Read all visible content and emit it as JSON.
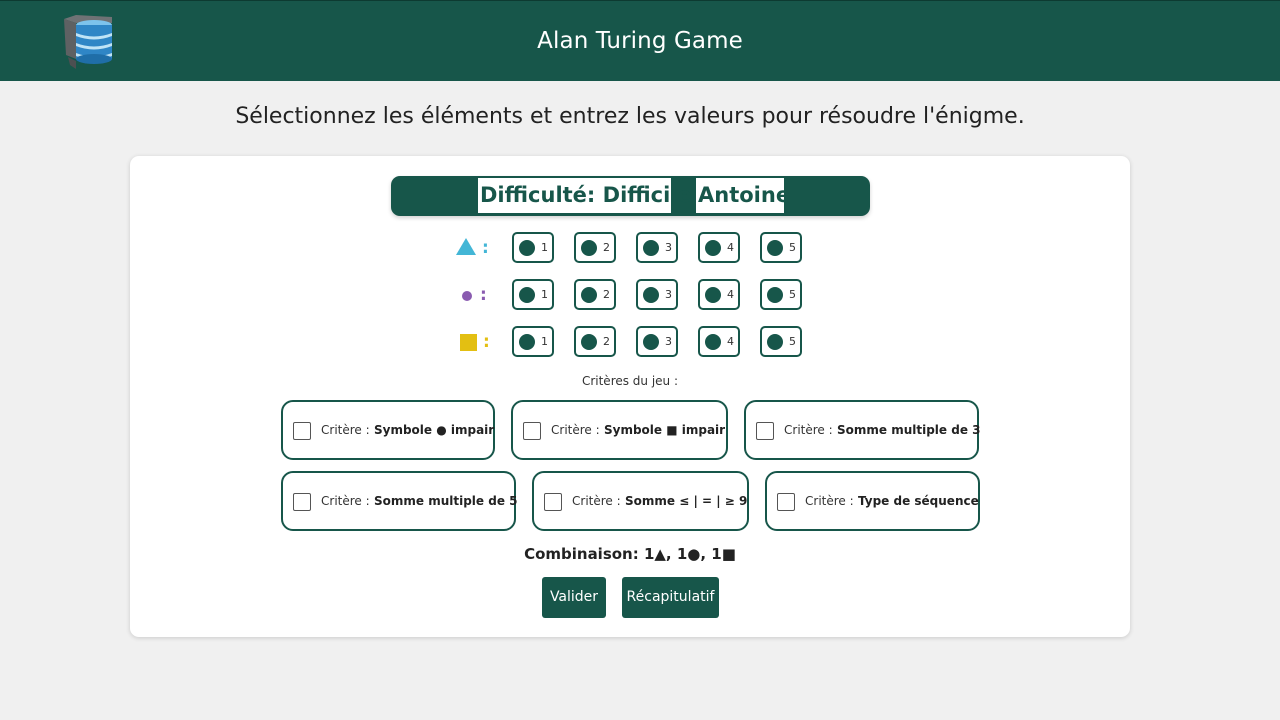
{
  "header": {
    "title": "Alan Turing Game",
    "logo_icon": "stacked-database-logo"
  },
  "instruction": "Sélectionnez les éléments et entrez les valeurs pour résoudre l'énigme.",
  "banner": {
    "difficulty": "Difficulté: Difficile",
    "player": "Antoine"
  },
  "rows": [
    {
      "symbol": "triangle",
      "color": "#43b6d6",
      "colon": ":",
      "options": [
        "1",
        "2",
        "3",
        "4",
        "5"
      ]
    },
    {
      "symbol": "circle",
      "color": "#8a5bb0",
      "colon": ":",
      "options": [
        "1",
        "2",
        "3",
        "4",
        "5"
      ]
    },
    {
      "symbol": "square",
      "color": "#e3bf12",
      "colon": ":",
      "options": [
        "1",
        "2",
        "3",
        "4",
        "5"
      ]
    }
  ],
  "criteria_title": "Critères du jeu :",
  "criteria": [
    {
      "label": "Critère :",
      "value": "Symbole ● impair",
      "checked": false
    },
    {
      "label": "Critère :",
      "value": "Symbole ■ impair",
      "checked": false
    },
    {
      "label": "Critère :",
      "value": "Somme multiple de 3",
      "checked": false
    },
    {
      "label": "Critère :",
      "value": "Somme multiple de 5",
      "checked": false
    },
    {
      "label": "Critère :",
      "value": "Somme ≤ | = | ≥ 9",
      "checked": false
    },
    {
      "label": "Critère :",
      "value": "Type de séquence",
      "checked": false
    }
  ],
  "combination": "Combinaison: 1▲, 1●, 1■",
  "buttons": {
    "validate": "Valider",
    "summary": "Récapitulatif"
  },
  "colors": {
    "primary": "#17564a",
    "background": "#f0f0f0",
    "card": "#ffffff"
  }
}
